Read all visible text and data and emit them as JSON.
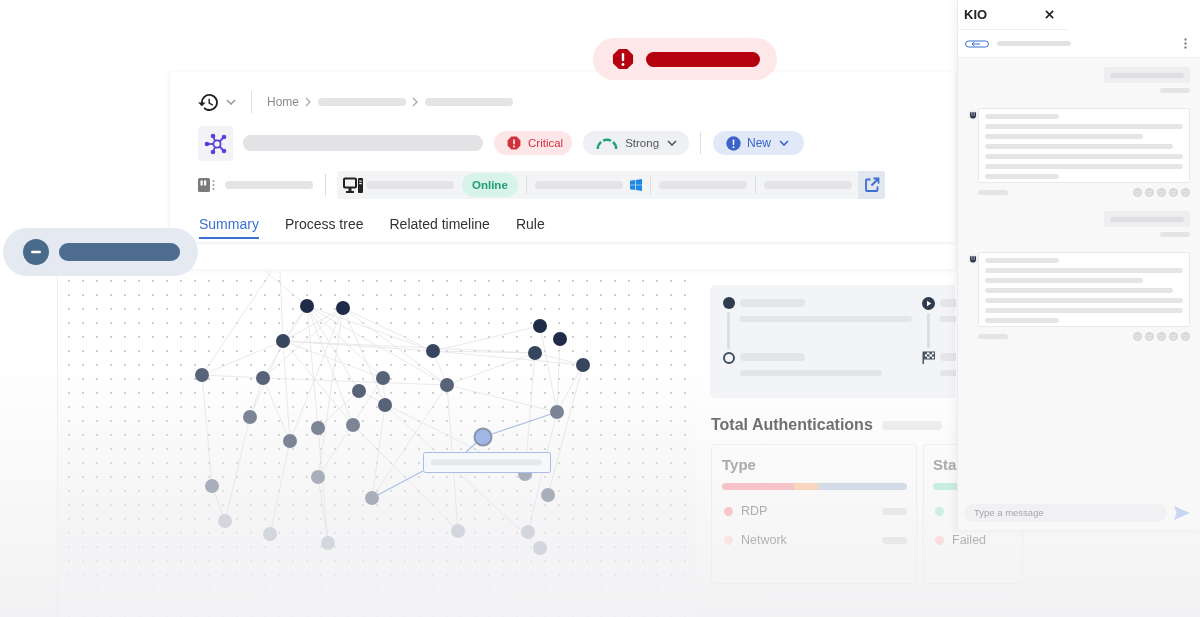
{
  "breadcrumb": [
    {
      "label": "Home"
    }
  ],
  "badges": [
    {
      "kind": "severity",
      "label": "Critical"
    },
    {
      "kind": "confidence",
      "label": "Strong"
    },
    {
      "kind": "status",
      "label": "New"
    }
  ],
  "device_bar": {
    "status": "Online"
  },
  "tabs": [
    {
      "label": "Summary",
      "selected": true
    },
    {
      "label": "Process tree",
      "selected": false
    },
    {
      "label": "Related timeline",
      "selected": false
    },
    {
      "label": "Rule",
      "selected": false
    }
  ],
  "authentications": {
    "title": "Total Authentications",
    "cards": [
      {
        "title": "Type",
        "legend": [
          {
            "label": "RDP",
            "color": "#f8c6cb"
          },
          {
            "label": "Network",
            "color": "#fbe3e5"
          }
        ]
      },
      {
        "title": "Sta",
        "legend": [
          {
            "color": "#cdeee2"
          },
          {
            "label": "Failed",
            "color": "#fbdde0"
          }
        ]
      }
    ]
  },
  "chat_panel": {
    "title": "KIO",
    "input": {
      "placeholder": "Type a message"
    }
  }
}
